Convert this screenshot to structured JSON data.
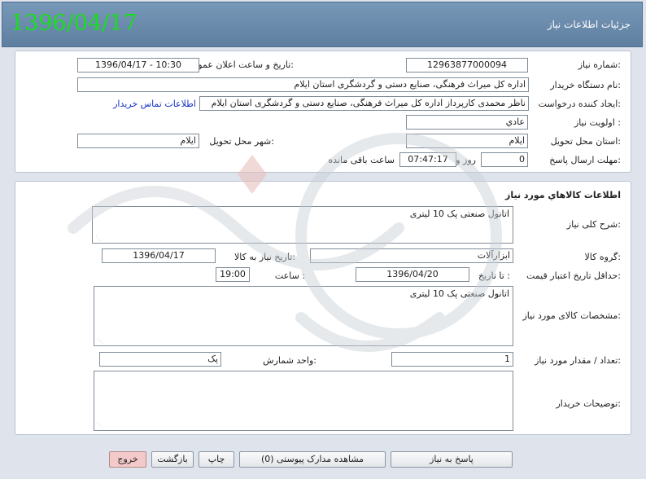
{
  "header": {
    "title": "جزئیات اطلاعات نیاز",
    "date_stamp": "1396/04/17"
  },
  "info": {
    "need_number_label": "شماره نیاز:",
    "need_number": "12963877000094",
    "announce_label": "تاریخ و ساعت اعلان عمومی:",
    "announce_value": "1396/04/17 - 10:30",
    "buyer_label": "نام دستگاه خریدار:",
    "buyer_value": "اداره کل میراث فرهنگی، صنایع دستی و گردشگری استان ایلام",
    "creator_label": "ایجاد کننده درخواست:",
    "creator_value": "ناظر محمدی کارپرداز اداره کل میراث فرهنگی، صنایع دستی و گردشگری استان ایلام",
    "contact_link": "اطلاعات تماس خریدار",
    "priority_label": "اولویت نیاز :",
    "priority_value": "عادي",
    "province_label": "استان محل تحویل:",
    "province_value": "ایلام",
    "city_label": "شهر محل تحویل:",
    "city_value": "ایلام",
    "deadline_label": "مهلت ارسال پاسخ:",
    "days_value": "0",
    "days_word": "روز و",
    "time_value": "07:47:17",
    "remaining_word": "ساعت باقی مانده"
  },
  "goods": {
    "section_title": "اطلاعات کالاهاي مورد نياز",
    "summary_label": "شرح کلی نیاز:",
    "summary_value": "اتانول صنعتی پک 10 لیتری",
    "group_label": "گروه کالا:",
    "group_value": "ابزارآلات",
    "need_date_label": "تاریخ نیاز به کالا:",
    "need_date_value": "1396/04/17",
    "price_validity_label": "حداقل تاریخ اعتبار قیمت:",
    "until_date_label": "تا تاریخ :",
    "until_date_value": "1396/04/20",
    "time_label": "ساعت :",
    "time_value": "19:00",
    "specs_label": "مشخصات کالای مورد نیاز:",
    "specs_value": "اتانول صنعتی پک 10 لیتری",
    "quantity_label": "تعداد / مقدار مورد نیاز:",
    "quantity_value": "1",
    "unit_label": "واحد شمارش:",
    "unit_value": "پک",
    "buyer_notes_label": "توضیحات خریدار:",
    "buyer_notes_value": ""
  },
  "buttons": {
    "reply": "پاسخ به نیاز",
    "attachments": "مشاهده مدارک پیوستی (0)",
    "print": "چاپ",
    "back": "بازگشت",
    "exit": "خروج"
  },
  "colors": {
    "header_bg": "#6b8bad",
    "date_stamp": "#16e01a",
    "link": "#1530c8",
    "exit_bg": "#f4c9c9"
  }
}
